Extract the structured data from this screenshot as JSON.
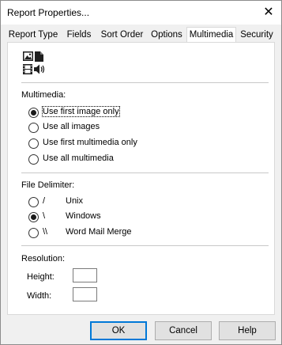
{
  "window": {
    "title": "Report Properties...",
    "close_glyph": "✕"
  },
  "tabs": [
    {
      "label": "Report Type"
    },
    {
      "label": "Fields"
    },
    {
      "label": "Sort Order"
    },
    {
      "label": "Options"
    },
    {
      "label": "Multimedia",
      "active": true
    },
    {
      "label": "Security"
    }
  ],
  "multimedia": {
    "icons": [
      "image-icon",
      "document-icon",
      "film-icon",
      "speaker-icon"
    ],
    "label": "Multimedia:",
    "options": [
      {
        "label": "Use first image only",
        "checked": true
      },
      {
        "label": "Use all images",
        "checked": false
      },
      {
        "label": "Use first multimedia only",
        "checked": false
      },
      {
        "label": "Use all multimedia",
        "checked": false
      }
    ]
  },
  "file_delimiter": {
    "label": "File Delimiter:",
    "options": [
      {
        "symbol": "/",
        "name": "Unix",
        "checked": false
      },
      {
        "symbol": "\\",
        "name": "Windows",
        "checked": true
      },
      {
        "symbol": "\\\\",
        "name": "Word Mail Merge",
        "checked": false
      }
    ]
  },
  "resolution": {
    "label": "Resolution:",
    "height_label": "Height:",
    "height_value": "",
    "width_label": "Width:",
    "width_value": ""
  },
  "buttons": {
    "ok": "OK",
    "cancel": "Cancel",
    "help": "Help"
  },
  "colors": {
    "accent": "#0078d7",
    "panel": "#ffffff",
    "dialog": "#f0f0f0"
  }
}
